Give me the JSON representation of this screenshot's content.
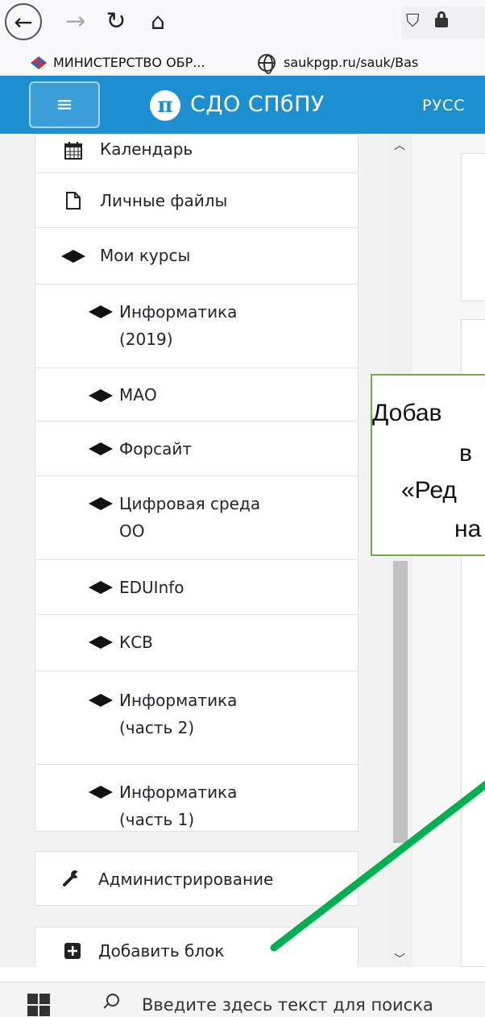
{
  "browser": {
    "bookmarks": [
      {
        "label": "МИНИСТЕРСТВО ОБР..."
      },
      {
        "label": "saukpgp.ru/sauk/Bas"
      }
    ]
  },
  "navbar": {
    "logo_text": "π",
    "site_name": "СДО СПбПУ",
    "language": "РУСС",
    "menu_icon": "≡"
  },
  "drawer": {
    "group1": [
      {
        "label": "Календарь",
        "icon": "calendar-icon"
      },
      {
        "label": "Личные файлы",
        "icon": "file-icon"
      },
      {
        "label": "Мои курсы",
        "icon": "graduation-cap-icon"
      },
      {
        "label": "Информатика (2019)",
        "line1": "Информатика",
        "line2": "(2019)",
        "icon": "graduation-cap-icon"
      },
      {
        "label": "МАО",
        "icon": "graduation-cap-icon"
      },
      {
        "label": "Форсайт",
        "icon": "graduation-cap-icon"
      },
      {
        "label": "Цифровая среда ОО",
        "line1": "Цифровая среда",
        "line2": "ОО",
        "icon": "graduation-cap-icon"
      },
      {
        "label": "EDUInfo",
        "icon": "graduation-cap-icon"
      },
      {
        "label": "КСВ",
        "icon": "graduation-cap-icon"
      },
      {
        "label": "Информатика (часть 2)",
        "line1": "Информатика",
        "line2": "(часть 2)",
        "icon": "graduation-cap-icon"
      },
      {
        "label": "Информатика (часть 1)",
        "line1": "Информатика",
        "line2": "(часть 1)",
        "icon": "graduation-cap-icon"
      }
    ],
    "admin": {
      "label": "Администрирование",
      "icon": "wrench-icon"
    },
    "add_block": {
      "label": "Добавить блок",
      "icon": "plus-square-icon"
    }
  },
  "callout": {
    "lines": [
      "Добав",
      "в",
      "«Ред",
      "на"
    ],
    "border_color": "#70ad47"
  },
  "arrow": {
    "color": "#00b050"
  },
  "taskbar": {
    "search_placeholder": "Введите здесь текст для поиска"
  },
  "colors": {
    "navbar": "#1b8fd0",
    "drawer_bg": "#f2f2f2"
  }
}
